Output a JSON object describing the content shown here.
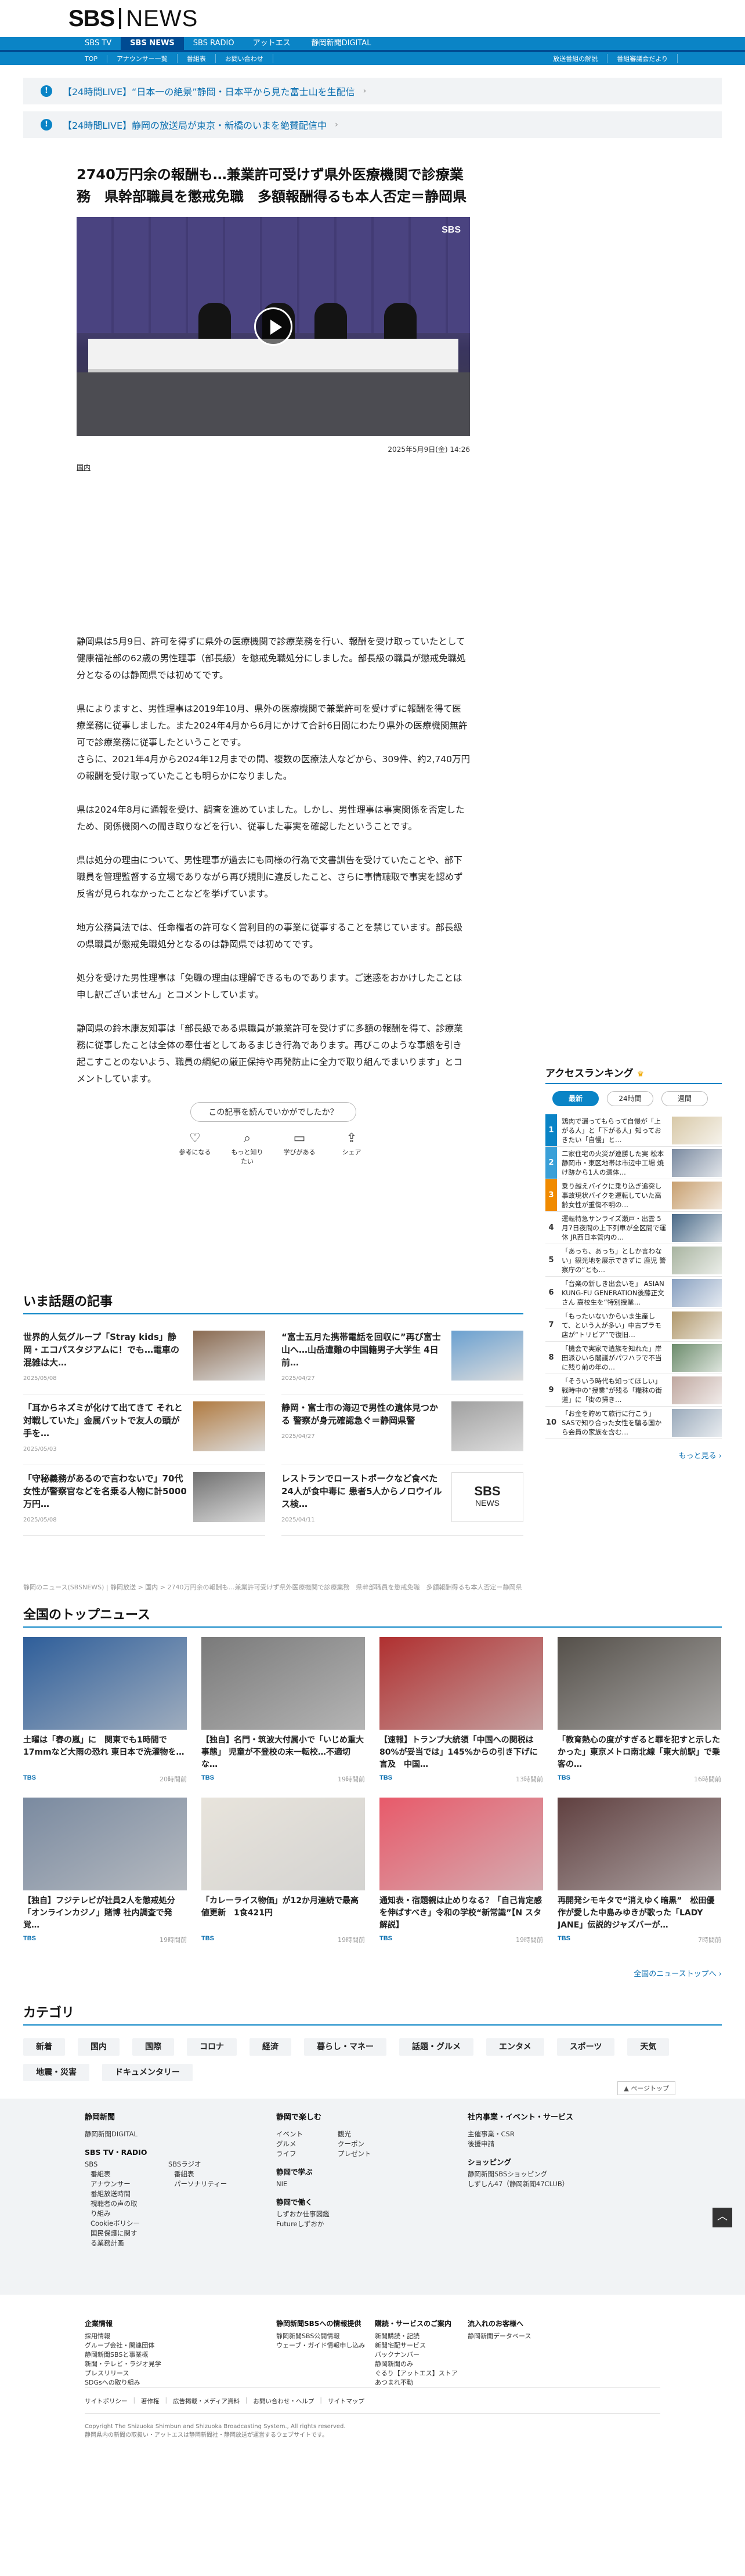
{
  "brand": {
    "main": "SBS",
    "sub": "NEWS"
  },
  "channel_nav": [
    "SBS TV",
    "SBS NEWS",
    "SBS RADIO",
    "アットエス",
    "静岡新聞DIGITAL"
  ],
  "sub_nav": {
    "left": [
      "TOP",
      "アナウンサー一覧",
      "番組表",
      "お問い合わせ"
    ],
    "right": [
      "放送番組の解説",
      "番組審議会だより"
    ]
  },
  "alerts": [
    "【24時間LIVE】“日本一の絶景”静岡・日本平から見た富士山を生配信",
    "【24時間LIVE】静岡の放送局が東京・新橋のいまを絶賛配信中"
  ],
  "article": {
    "title": "2740万円余の報酬も…兼業許可受けず県外医療機関で診療業務　県幹部職員を懲戒免職　多額報酬得るも本人否定＝静岡県",
    "video_watermark": "SBS",
    "date": "2025年5月9日(金) 14:26",
    "category": "国内",
    "paragraphs": [
      "静岡県は5月9日、許可を得ずに県外の医療機関で診療業務を行い、報酬を受け取っていたとして健康福祉部の62歳の男性理事（部長級）を懲戒免職処分にしました。部長級の職員が懲戒免職処分となるのは静岡県では初めてです。",
      "県によりますと、男性理事は2019年10月、県外の医療機関で兼業許可を受けずに報酬を得て医療業務に従事しました。また2024年4月から6月にかけて合計6日間にわたり県外の医療機関無許可で診療業務に従事したということです。\nさらに、2021年4月から2024年12月までの間、複数の医療法人などから、309件、約2,740万円の報酬を受け取っていたことも明らかになりました。",
      "県は2024年8月に通報を受け、調査を進めていました。しかし、男性理事は事実関係を否定したため、関係機関への聞き取りなどを行い、従事した事実を確認したということです。",
      "県は処分の理由について、男性理事が過去にも同様の行為で文書訓告を受けていたことや、部下職員を管理監督する立場でありながら再び規則に違反したこと、さらに事情聴取で事実を認めず反省が見られなかったことなどを挙げています。",
      "地方公務員法では、任命権者の許可なく営利目的の事業に従事することを禁じています。部長級の県職員が懲戒免職処分となるのは静岡県では初めてです。",
      "処分を受けた男性理事は「免職の理由は理解できるものであります。ご迷惑をおかけしたことは申し訳ございません」とコメントしています。",
      "静岡県の鈴木康友知事は「部長級である県職員が兼業許可を受けずに多額の報酬を得て、診療業務に従事したことは全体の奉仕者としてあるまじき行為であります。再びこのような事態を引き起こすことのないよう、職員の綱紀の厳正保持や再発防止に全力で取り組んでまいります」とコメントしています。"
    ],
    "reaction_question": "この記事を読んでいかがでしたか？",
    "reactions": [
      "参考になる",
      "もっと知りたい",
      "学びがある",
      "シェア"
    ]
  },
  "ranking": {
    "title": "アクセスランキング",
    "tabs": [
      "最新",
      "24時間",
      "週間"
    ],
    "items": [
      {
        "rank": "1",
        "title": "鶏肉で漏ってもらって自慢が「上がる人」と「下がる人」知っておきたい「自慢」と…"
      },
      {
        "rank": "2",
        "title": "二家住宅の火災が連勝した実 松本 静岡市・東区地帯は市辺中工場 焼け跡から1人の遺体…"
      },
      {
        "rank": "3",
        "title": "乗り越えバイクに乗り込ぎ追突し事故現状バイクを運転していた高齢女性が重傷不明の…"
      },
      {
        "rank": "4",
        "title": "運転特急サンライズ瀬戸・出雲 5月7日夜間の上下列車が全区間で運休 JR西日本管内の…"
      },
      {
        "rank": "5",
        "title": "「あっち、あっち」としか言わない」観光地を展示できずに 鹿児 警察庁の“とも…"
      },
      {
        "rank": "6",
        "title": "「音楽の新しき出会いを」 ASIAN KUNG-FU GENERATION後藤正文さん 高校生を“特別授業…"
      },
      {
        "rank": "7",
        "title": "「もったいないからいま生産して、という人が多い」中古プラモ店が“トリビア”で復旧…"
      },
      {
        "rank": "8",
        "title": "「機会で実家で遺族を知れた」岸田派ひいら閣議がパワハラで不当に残り前の年の…"
      },
      {
        "rank": "9",
        "title": "「そういう時代も知ってほしい」戦時中の“授業”が残る「糧秣の街道」に「街の掃き…"
      },
      {
        "rank": "10",
        "title": "「お金を貯めて旅行に行こう」SASで知り合った女性を騙る国から会員の家族を含む…"
      }
    ],
    "more": "もっと見る"
  },
  "trending": {
    "title": "いま話題の記事",
    "items": [
      {
        "title": "世界的人気グループ「Stray kids」静岡・エコパスタジアムに！でも…電車の混雑は大…",
        "date": "2025/05/08"
      },
      {
        "title": "“富士五月た携帯電話を回収に”再び富士山へ…山岳遭難の中国籍男子大学生 4日前…",
        "date": "2025/04/27"
      },
      {
        "title": "「耳からネズミが化けて出てきて それと対戦していた」金属バットで友人の頭が手を…",
        "date": "2025/05/03"
      },
      {
        "title": "静岡・富士市の海辺で男性の遺体見つかる 警察が身元確認急ぐ＝静岡県警",
        "date": "2025/04/27"
      },
      {
        "title": "「守秘義務があるので言わないで」70代女性が警察官などを名乗る人物に計5000万円…",
        "date": "2025/05/08"
      },
      {
        "title": "レストランでローストポークなど食べた24人が食中毒に 患者5人からノロウイルス検…",
        "date": "2025/04/11"
      }
    ]
  },
  "breadcrumb": "静岡のニュース(SBSNEWS) | 静岡放送 > 国内 > 2740万円余の報酬も…兼業許可受けず県外医療機関で診療業務　県幹部職員を懲戒免職　多額報酬得るも本人否定＝静岡県",
  "top_news": {
    "title": "全国のトップニュース",
    "items": [
      {
        "title": "土曜は「春の嵐」に　関東でも1時間で17mmなど大雨の恐れ 東日本で洗濯物を…",
        "src": "TBS",
        "time": "20時間前"
      },
      {
        "title": "【独自】名門・筑波大付属小で「いじめ重大事態」 児童が不登校の末一転校…不適切な…",
        "src": "TBS",
        "time": "19時間前"
      },
      {
        "title": "【速報】トランプ大統領「中国への関税は80%が妥当では」145%からの引き下げに言及　中国…",
        "src": "TBS",
        "time": "13時間前"
      },
      {
        "title": "「教育熱心の度がすぎると罪を犯すと示したかった」東京メトロ南北線「東大前駅」で乗客の…",
        "src": "TBS",
        "time": "16時間前"
      },
      {
        "title": "【独自】フジテレビが社員2人を懲戒処分 「オンラインカジノ」賭博 社内調査で発覚…",
        "src": "TBS",
        "time": "19時間前"
      },
      {
        "title": "「カレーライス物価」が12か月連続で最高値更新　1食421円",
        "src": "TBS",
        "time": "19時間前"
      },
      {
        "title": "通知表・宿題親は止めりなる？「自己肯定感を伸ばすべき」令和の学校“新常識”【N スタ解説】",
        "src": "TBS",
        "time": "19時間前"
      },
      {
        "title": "再開発シモキタで“消えゆく暗黒”　松田優作が愛した中島みゆきが歌った「LADY JANE」伝説的ジャズバーが…",
        "src": "TBS",
        "time": "7時間前"
      }
    ],
    "more": "全国のニューストップへ"
  },
  "categories": {
    "title": "カテゴリ",
    "items": [
      "新着",
      "国内",
      "国際",
      "コロナ",
      "経済",
      "暮らし・マネー",
      "話題・グルメ",
      "エンタメ",
      "スポーツ",
      "天気",
      "地震・災害",
      "ドキュメンタリー"
    ]
  },
  "page_top": "ページトップ",
  "footer": {
    "col1": {
      "h": "静岡新聞",
      "items": [
        "静岡新聞DIGITAL"
      ],
      "h2": "SBS TV・RADIO",
      "a": [
        "SBS",
        "番組表",
        "アナウンサー",
        "番組放送時間",
        "視聴者の声の取り組み",
        "Cookieポリシー",
        "国民保護に関する業務計画"
      ],
      "b": [
        "SBSラジオ",
        "番組表",
        "パーソナリティー"
      ]
    },
    "col2": {
      "h": "静岡で楽しむ",
      "a": [
        "イベント",
        "グルメ",
        "ライフ"
      ],
      "b": [
        "観光",
        "クーポン",
        "プレゼント"
      ],
      "h2": "静岡で学ぶ",
      "c": [
        "NIE"
      ],
      "h3": "静岡で働く",
      "d": [
        "しずおか仕事図鑑",
        "Futureしずおか"
      ]
    },
    "col3": {
      "h": "社内事業・イベント・サービス",
      "a": [
        "主催事業・CSR",
        "後援申請"
      ],
      "h2": "ショッピング",
      "b": [
        "静岡新聞SBSショッピング",
        "しずしん47（静岡新聞47CLUB）"
      ]
    },
    "row2": [
      {
        "h": "企業情報",
        "items": [
          "採用情報",
          "グループ会社・関連団体",
          "静岡新聞SBSと事業概",
          "新聞・テレビ・ラジオ見学",
          "プレスリリース",
          "SDGsへの取り組み"
        ]
      },
      {
        "h": "静岡新聞SBSへの情報提供",
        "items": [
          "静岡新聞SBS公開情報",
          "ウェーブ・ガイド情報申し込み"
        ]
      },
      {
        "h": "購読・サービスのご案内",
        "items": [
          "新聞購読・記読",
          "新聞宅配サービス",
          "バックナンバー",
          "静岡新聞のみ",
          "ぐるり【アットエス】ストア",
          "あつまれ不動"
        ]
      },
      {
        "h": "流入れのお客様へ",
        "items": [
          "静岡新聞データベース"
        ]
      }
    ],
    "links": [
      "サイトポリシー",
      "著作権",
      "広告掲載・メディア資料",
      "お問い合わせ・ヘルプ",
      "サイトマップ"
    ],
    "copy": "Copyright The Shizuoka Shimbun and Shizuoka Broadcasting System., All rights reserved.\n静岡県内の新聞の取扱い・アットエスは静岡新聞社・静岡放送が運営するウェブサイトです。"
  },
  "colors": {
    "primary": "#0a84c6",
    "navy": "#004b92",
    "link": "#0a6fb0"
  }
}
